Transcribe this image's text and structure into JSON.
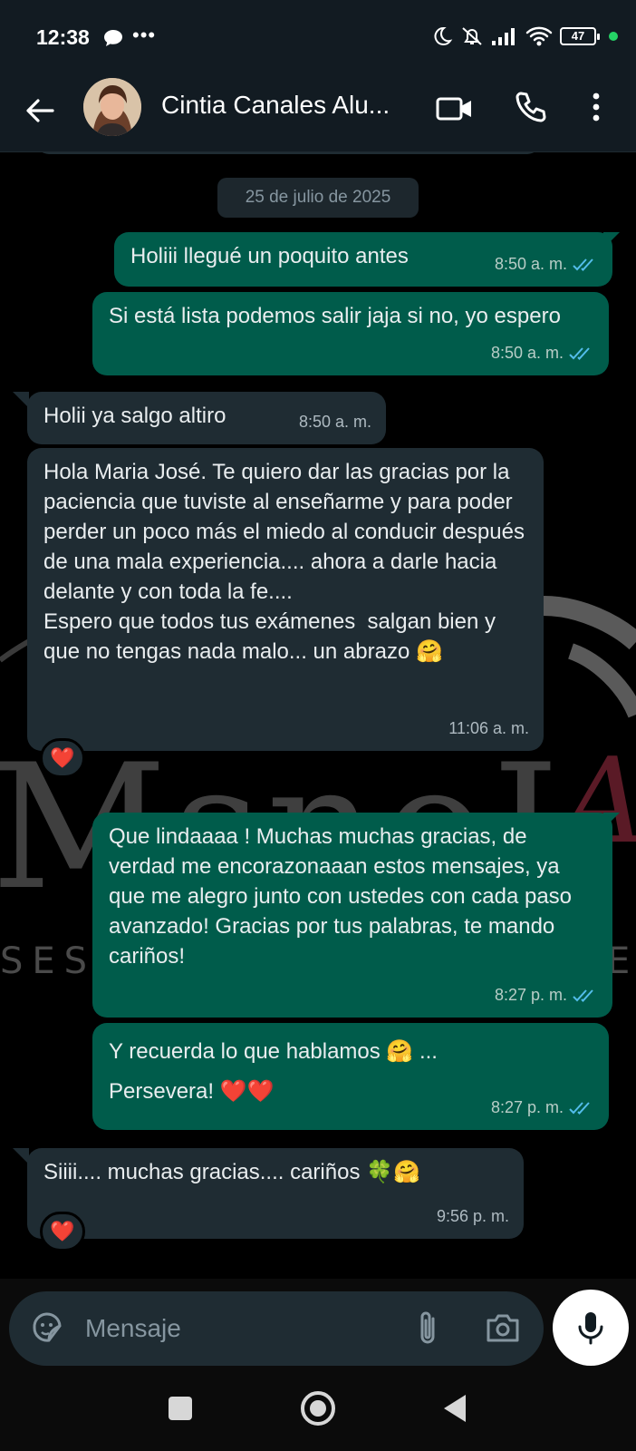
{
  "status_bar": {
    "time": "12:38",
    "dots": "•••",
    "battery": "47"
  },
  "header": {
    "contact_name": "Cintia Canales Alu...",
    "avatar_icon": "contact-avatar",
    "video_icon": "video-call-icon",
    "call_icon": "phone-icon",
    "menu_icon": "more-vert-icon"
  },
  "chat": {
    "date_chip": "25 de julio de 2025",
    "messages": [
      {
        "dir": "out",
        "text": "Holiii llegué un poquito antes",
        "time": "8:50 a. m."
      },
      {
        "dir": "out",
        "text": "Si está lista podemos salir jaja si no, yo espero",
        "time": "8:50 a. m."
      },
      {
        "dir": "in",
        "text": "Holii ya salgo altiro",
        "time": "8:50 a. m."
      },
      {
        "dir": "in",
        "text": "Hola Maria José. Te quiero dar las gracias por la paciencia que tuviste al enseñarme y para poder perder un poco más el miedo al conducir después de una mala experiencia.... ahora a darle hacia delante y con toda la fe....\nEspero que todos tus exámenes  salgan bien y que no tengas nada malo... un abrazo 🤗",
        "time": "11:06 a. m.",
        "reaction": "❤️"
      },
      {
        "dir": "out",
        "text": "Que lindaaaa ! Muchas muchas gracias, de verdad me encorazonaaan estos mensajes, ya que me alegro junto con ustedes con cada paso avanzado! Gracias por tus palabras, te mando cariños!",
        "time": "8:27 p. m."
      },
      {
        "dir": "out",
        "text": "Y recuerda lo que hablamos 🤗 ...\nPersevera! ❤️❤️",
        "time": "8:27 p. m."
      },
      {
        "dir": "in",
        "text": "Siiii.... muchas gracias.... cariños 🍀🤗",
        "time": "9:56 p. m.",
        "reaction": "❤️"
      }
    ]
  },
  "input_bar": {
    "placeholder": "Mensaje"
  },
  "colors": {
    "outgoing_bubble": "#005c4b",
    "incoming_bubble": "#1f2c33",
    "read_ticks": "#53bdeb",
    "header_bg": "#121b22"
  }
}
